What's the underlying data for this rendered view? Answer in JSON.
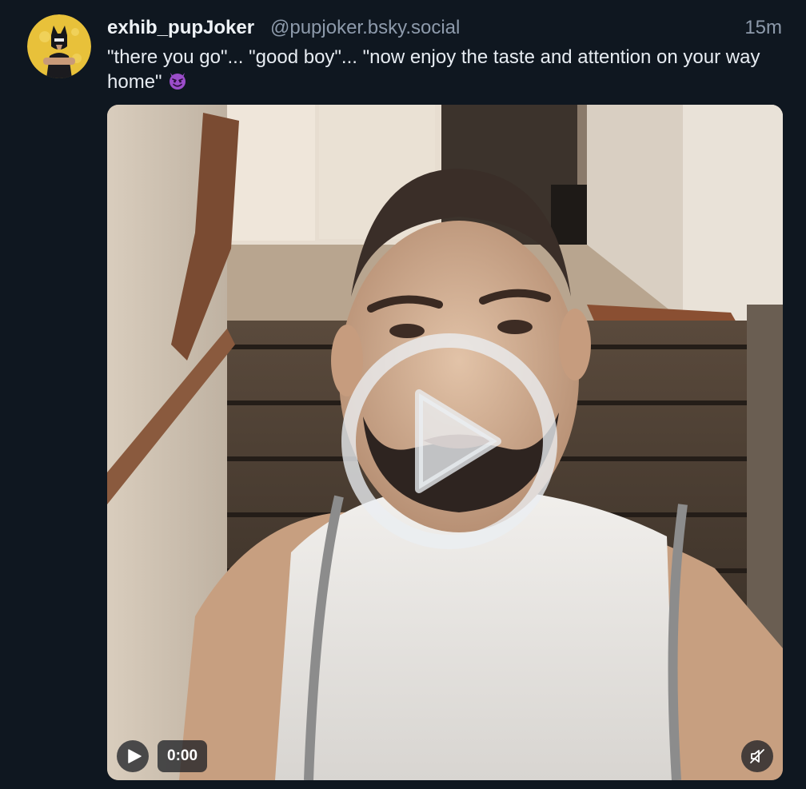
{
  "post": {
    "author": {
      "display_name": "exhib_pupJoker",
      "handle": "@pupjoker.bsky.social"
    },
    "timestamp": "15m",
    "text": "\"there you go\"... \"good boy\"... \"now enjoy the taste and attention on your way home\"",
    "emoji": "smiling-face-with-horns-emoji",
    "video": {
      "time_label": "0:00",
      "state": "paused",
      "muted": true
    }
  },
  "icons": {
    "play_overlay": "play-circle-icon",
    "play": "play-icon",
    "mute": "speaker-muted-icon"
  }
}
